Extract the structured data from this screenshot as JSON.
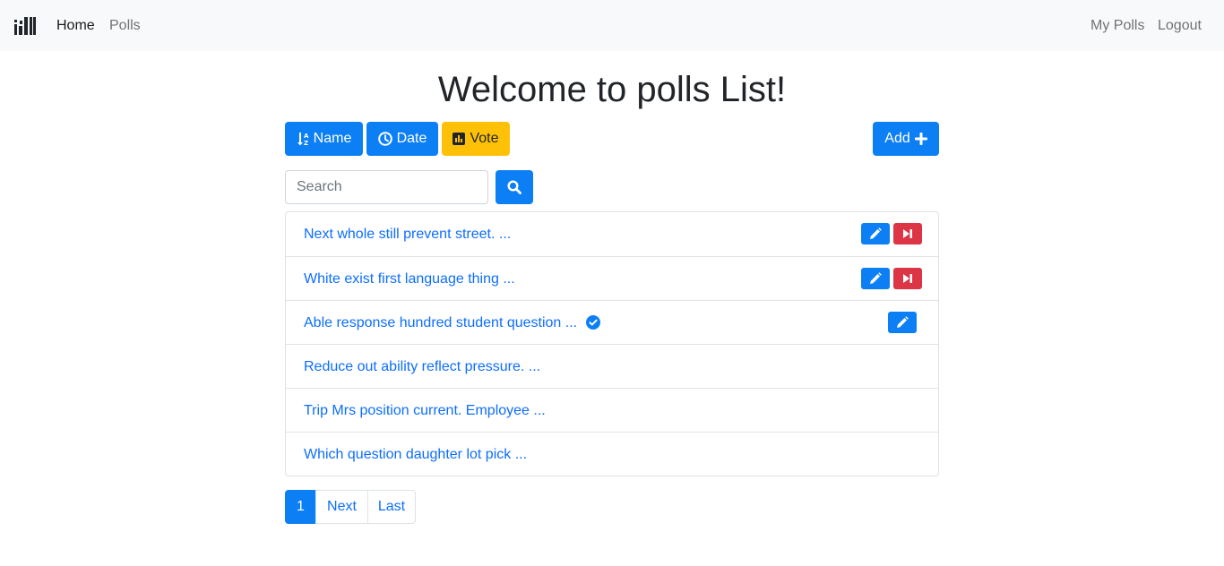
{
  "navbar": {
    "brand_icon": "poll-logo-icon",
    "home_label": "Home",
    "polls_label": "Polls",
    "my_polls_label": "My Polls",
    "logout_label": "Logout"
  },
  "page_title": "Welcome to polls List!",
  "toolbar": {
    "sort_name_label": "Name",
    "sort_name_icon": "sort-alpha-down-icon",
    "sort_date_label": "Date",
    "sort_date_icon": "clock-icon",
    "sort_vote_label": "Vote",
    "sort_vote_icon": "bar-chart-icon",
    "add_label": "Add",
    "add_icon": "plus-icon"
  },
  "search": {
    "placeholder": "Search",
    "value": "",
    "button_icon": "search-icon"
  },
  "polls": [
    {
      "title": "Next whole still prevent street. ...",
      "verified": false,
      "actions": [
        "edit",
        "end"
      ]
    },
    {
      "title": "White exist first language thing ...",
      "verified": false,
      "actions": [
        "edit",
        "end"
      ]
    },
    {
      "title": "Able response hundred student question ...",
      "verified": true,
      "actions": [
        "edit"
      ]
    },
    {
      "title": "Reduce out ability reflect pressure. ...",
      "verified": false,
      "actions": []
    },
    {
      "title": "Trip Mrs position current. Employee ...",
      "verified": false,
      "actions": []
    },
    {
      "title": "Which question daughter lot pick ...",
      "verified": false,
      "actions": []
    }
  ],
  "pagination": {
    "current": "1",
    "next_label": "Next",
    "last_label": "Last"
  },
  "colors": {
    "primary": "#0d7ff5",
    "warning": "#ffc107",
    "danger": "#dc3545",
    "link": "#0d6efd",
    "navbar_bg": "#f8f9fa"
  }
}
